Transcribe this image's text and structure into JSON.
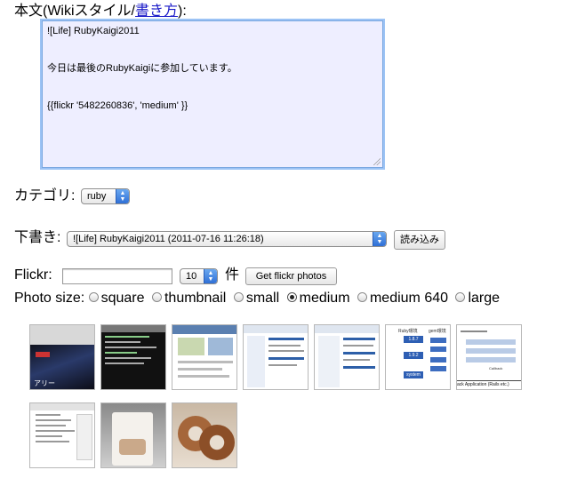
{
  "body_label": {
    "prefix": "本文(Wikiスタイル/",
    "link": "書き方",
    "suffix": "):"
  },
  "body_text": {
    "line1": "![Life] RubyKaigi2011",
    "line2": "今日は最後のRubyKaigiに参加しています。",
    "line3": "{{flickr '5482260836', 'medium' }}"
  },
  "category": {
    "label": "カテゴリ:",
    "selected": "ruby"
  },
  "draft": {
    "label": "下書き:",
    "selected": "![Life] RubyKaigi2011 (2011-07-16 11:26:18)",
    "load_button": "読み込み"
  },
  "flickr": {
    "label": "Flickr:",
    "input_value": "",
    "count_selected": "10",
    "count_unit": "件",
    "get_button": "Get flickr photos"
  },
  "photo_size": {
    "label": "Photo size:",
    "options": [
      {
        "label": "square",
        "selected": false
      },
      {
        "label": "thumbnail",
        "selected": false
      },
      {
        "label": "small",
        "selected": false
      },
      {
        "label": "medium",
        "selected": true
      },
      {
        "label": "medium 640",
        "selected": false
      },
      {
        "label": "large",
        "selected": false
      }
    ]
  },
  "thumbnails": {
    "t1_text": "アリー",
    "t5_labels": [
      "Ruby環境",
      "gem環境",
      "1.8.7",
      "1.9.2",
      "system"
    ],
    "t6_labels": [
      "ack Application (Rails etc.)",
      "Callback"
    ]
  },
  "colors": {
    "textarea_bg": "#eeeeff",
    "focus_ring": "#9cc3f5",
    "select_arrow": "#2f6fd6",
    "link": "#1a1ac8"
  }
}
